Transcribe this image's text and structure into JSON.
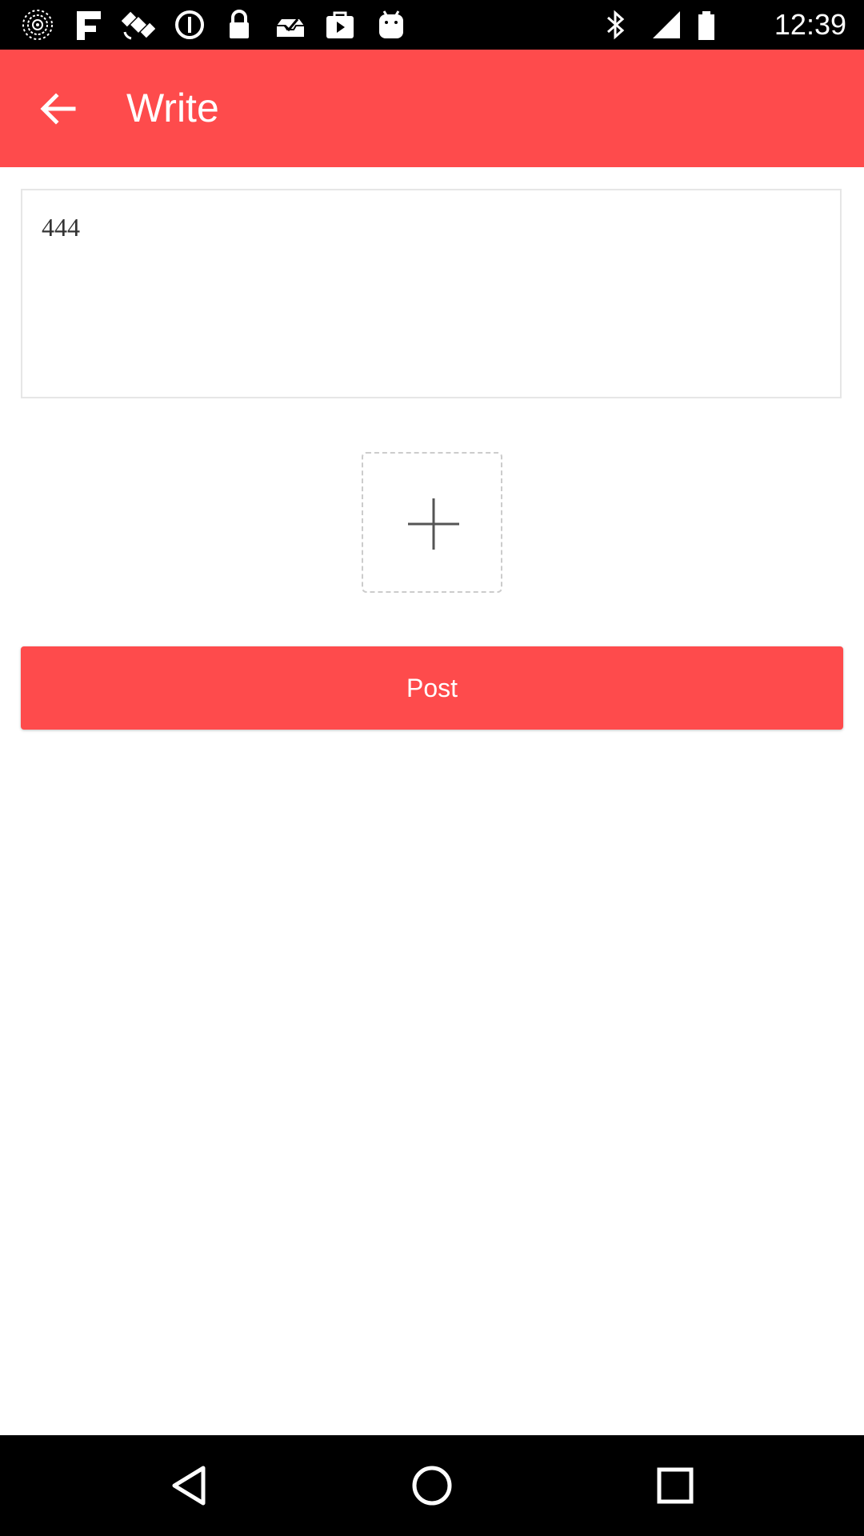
{
  "status_bar": {
    "time": "12:39",
    "icons": [
      "radar-icon",
      "fake-gps-icon",
      "satellite-icon",
      "alert-circle-icon",
      "lock-icon",
      "inbox-check-icon",
      "play-store-icon",
      "android-icon",
      "bluetooth-icon",
      "signal-icon",
      "battery-icon"
    ]
  },
  "app_bar": {
    "back_icon": "arrow-back-icon",
    "title": "Write",
    "color": "#fe4b4c"
  },
  "editor": {
    "text": "444"
  },
  "add_image": {
    "icon": "plus-icon"
  },
  "post_button": {
    "label": "Post",
    "color": "#fe4b4c"
  },
  "nav_bar": {
    "icons": [
      "back-triangle-icon",
      "home-circle-icon",
      "recents-square-icon"
    ]
  }
}
